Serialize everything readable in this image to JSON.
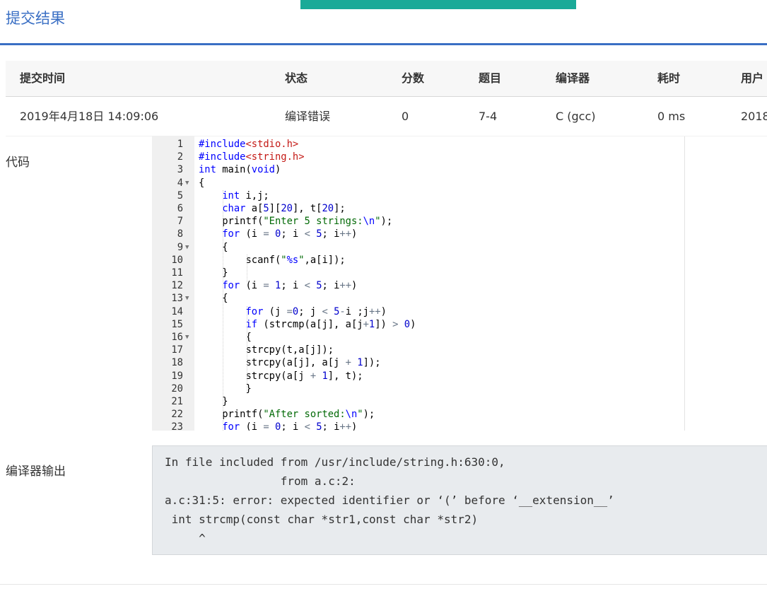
{
  "page": {
    "title": "提交结果"
  },
  "table": {
    "headers": [
      "提交时间",
      "状态",
      "分数",
      "题目",
      "编译器",
      "耗时",
      "用户"
    ],
    "row": {
      "time": "2019年4月18日 14:09:06",
      "status": "编译错误",
      "score": "0",
      "problem": "7-4",
      "compiler": "C (gcc)",
      "duration": "0 ms",
      "user": "2018"
    }
  },
  "labels": {
    "code": "代码",
    "compiler_output": "编译器输出"
  },
  "code_lines": [
    "#include<stdio.h>",
    "#include<string.h>",
    "int main(void)",
    "{",
    "    int i,j;",
    "    char a[5][20], t[20];",
    "    printf(\"Enter 5 strings:\\n\");",
    "    for (i = 0; i < 5; i++)",
    "    {",
    "        scanf(\"%s\",a[i]);",
    "    }",
    "    for (i = 1; i < 5; i++)",
    "    {",
    "        for (j =0; j < 5-i ;j++)",
    "        if (strcmp(a[j], a[j+1]) > 0)",
    "        {",
    "        strcpy(t,a[j]);",
    "        strcpy(a[j], a[j + 1]);",
    "        strcpy(a[j + 1], t);",
    "        }",
    "    }",
    "    printf(\"After sorted:\\n\");",
    "    for (i = 0; i < 5; i++)"
  ],
  "compiler_output": [
    "In file included from /usr/include/string.h:630:0,",
    "                 from a.c:2:",
    "a.c:31:5: error: expected identifier or ‘(’ before ‘__extension__’",
    " int strcmp(const char *str1,const char *str2)",
    "     ^"
  ]
}
